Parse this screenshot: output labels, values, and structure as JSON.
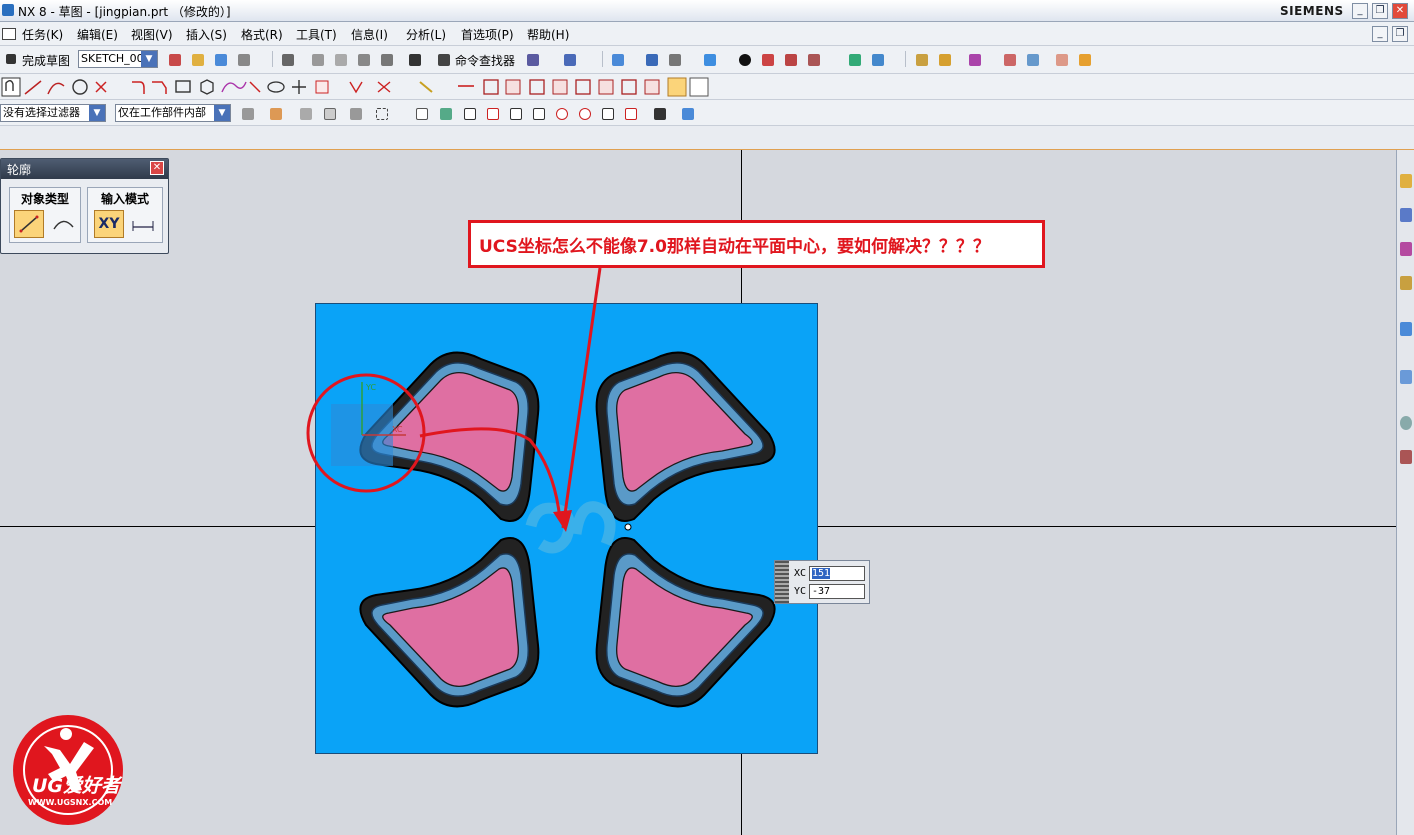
{
  "window": {
    "title": "NX 8 - 草图 - [jingpian.prt （修改的）]",
    "brand": "SIEMENS",
    "buttons": [
      "_",
      "❐",
      "✕"
    ],
    "inner_buttons": [
      "_",
      "❐"
    ]
  },
  "menu": {
    "items": [
      "任务(K)",
      "编辑(E)",
      "视图(V)",
      "插入(S)",
      "格式(R)",
      "工具(T)",
      "信息(I)",
      "分析(L)",
      "首选项(P)",
      "帮助(H)"
    ]
  },
  "toolbar1": {
    "finish_sketch": "完成草图",
    "sketch_name": "SKETCH_001",
    "command_finder": "命令查找器"
  },
  "toolbar3": {
    "type_filter": "没有选择过滤器",
    "scope_filter": "仅在工作部件内部"
  },
  "profile_palette": {
    "title": "轮廓",
    "close_label": "✕",
    "object_type_title": "对象类型",
    "input_mode_title": "输入模式",
    "xy_label": "XY"
  },
  "annotation": {
    "text": "UCS坐标怎么不能像7.0那样自动在平面中心，要如何解决？？？？"
  },
  "csys": {
    "xc_label": "XC",
    "yc_label": "YC"
  },
  "coord_input": {
    "xc_label": "XC",
    "yc_label": "YC",
    "xc_value": "151",
    "yc_value": "-37"
  },
  "watermark": {
    "brand": "UG爱好者",
    "url": "WWW.UGSNX.COM"
  },
  "colors": {
    "part_face": "#0aa3f7",
    "petal_fill": "#df6fa2",
    "annotation_red": "#e0161e",
    "viewport_bg": "#d5d8de"
  }
}
